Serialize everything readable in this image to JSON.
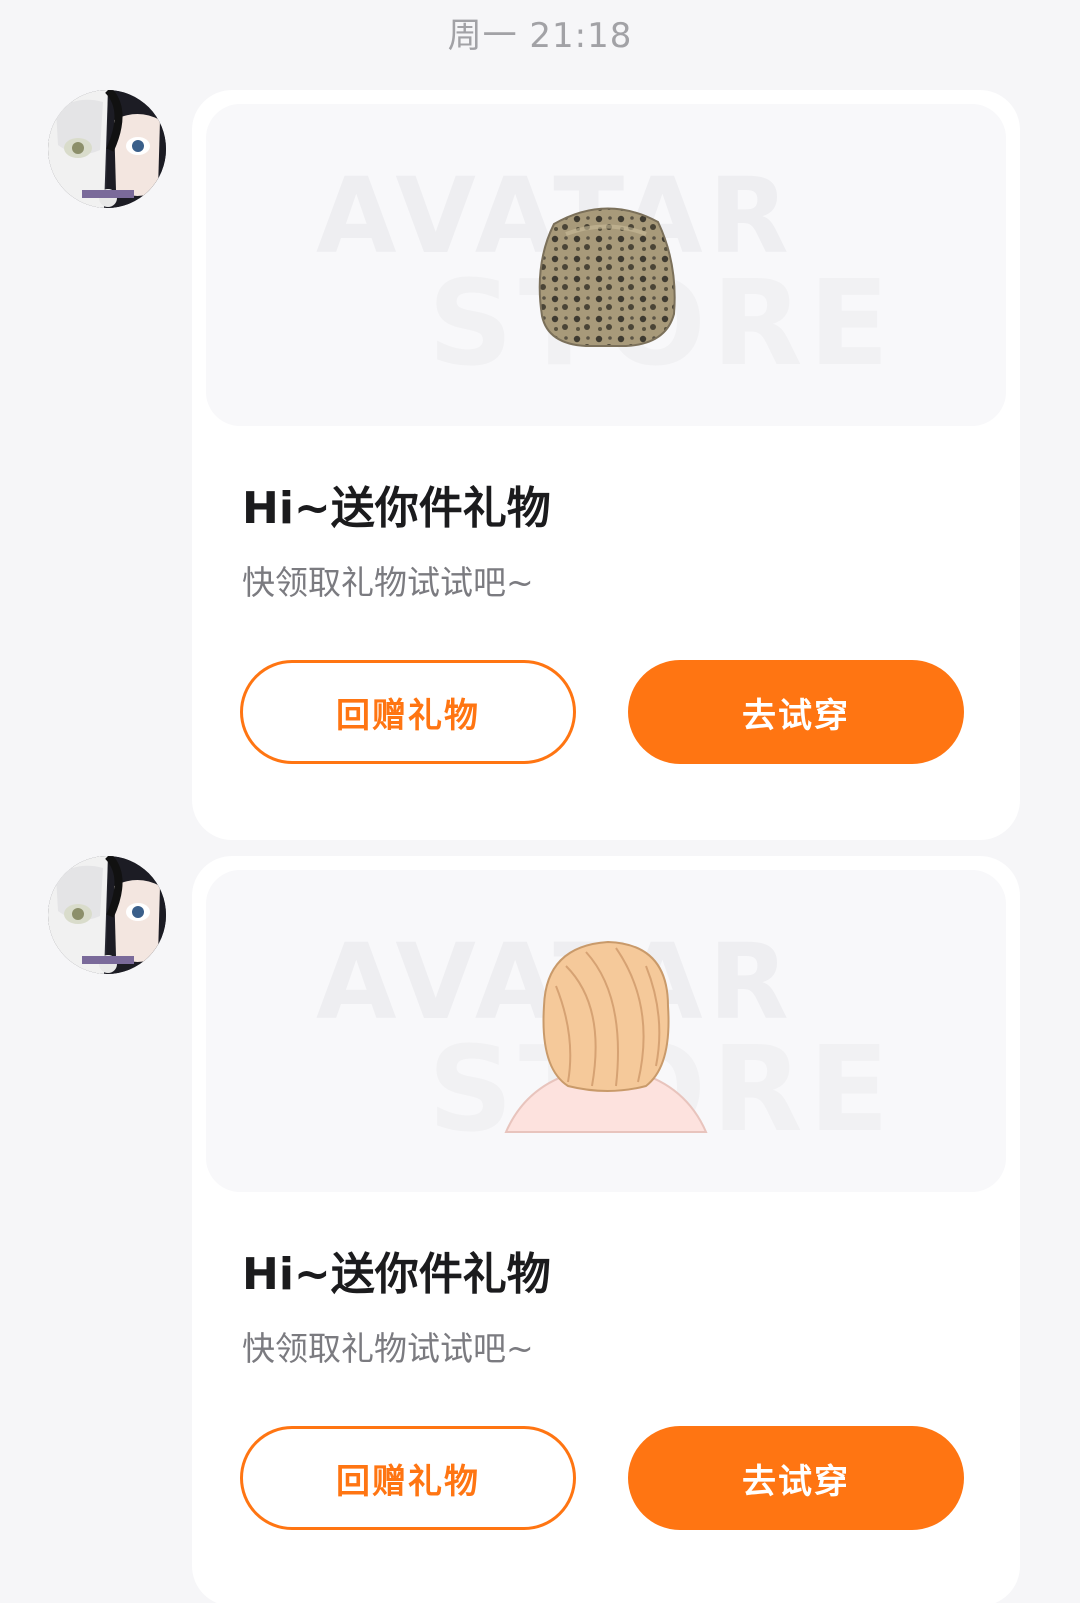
{
  "timestamp": "周一 21:18",
  "watermark": {
    "line1": "AVATAR",
    "line2": "STORE"
  },
  "theme": {
    "accent": "#ff7512",
    "background": "#f6f6f8",
    "card": "#ffffff"
  },
  "messages": [
    {
      "sender_avatar": "anime-avatar",
      "item_icon": "leopard-print-hat-icon",
      "title": "Hi~送你件礼物",
      "subtitle": "快领取礼物试试吧~",
      "return_gift_label": "回赠礼物",
      "try_on_label": "去试穿"
    },
    {
      "sender_avatar": "anime-avatar",
      "item_icon": "blonde-hair-icon",
      "title": "Hi~送你件礼物",
      "subtitle": "快领取礼物试试吧~",
      "return_gift_label": "回赠礼物",
      "try_on_label": "去试穿"
    }
  ]
}
